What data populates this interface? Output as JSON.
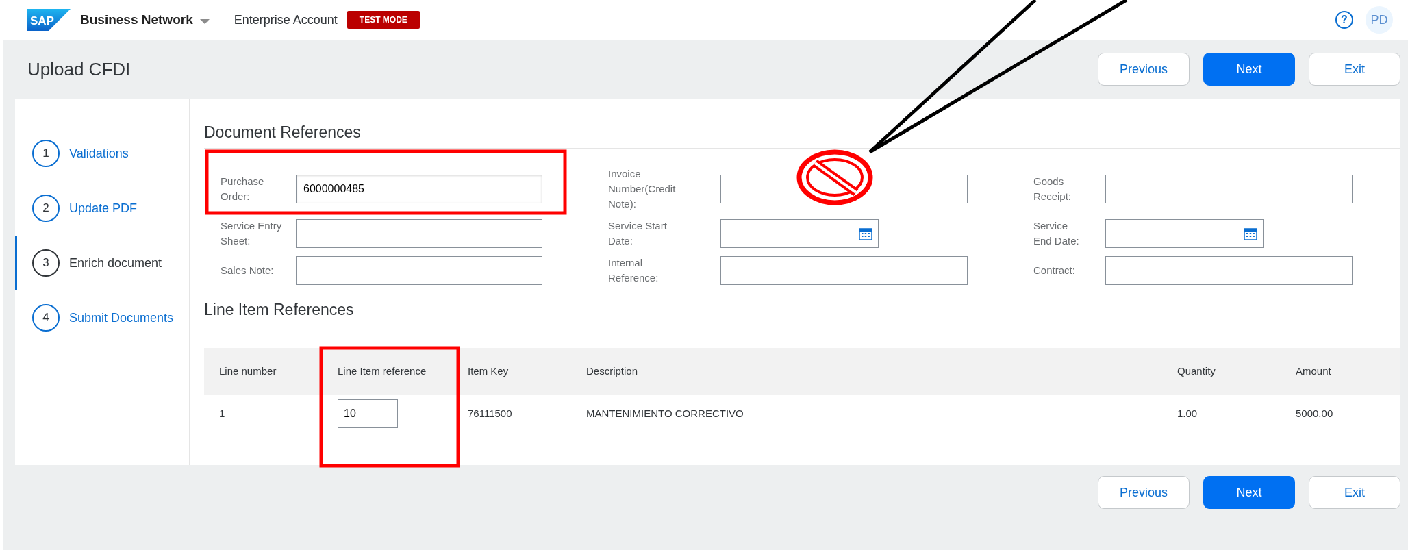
{
  "header": {
    "logo": "SAP",
    "product": "Business Network",
    "account": "Enterprise Account",
    "mode_badge": "TEST MODE",
    "help": "?",
    "avatar": "PD"
  },
  "page": {
    "title": "Upload CFDI",
    "actions": [
      {
        "label": "Previous",
        "kind": "secondary"
      },
      {
        "label": "Next",
        "kind": "primary"
      },
      {
        "label": "Exit",
        "kind": "secondary"
      }
    ]
  },
  "steps": [
    {
      "number": "1",
      "label": "Validations",
      "selected": false
    },
    {
      "number": "2",
      "label": "Update PDF",
      "selected": false
    },
    {
      "number": "3",
      "label": "Enrich document",
      "selected": true
    },
    {
      "number": "4",
      "label": "Submit Documents",
      "selected": false
    }
  ],
  "document_references": {
    "title": "Document References",
    "fields": [
      {
        "label": "Purchase Order:",
        "value": "6000000485",
        "kind": "text"
      },
      {
        "label": "Invoice Number(Credit Note):",
        "kind": "text"
      },
      {
        "label": "Goods Receipt:",
        "kind": "text"
      },
      {
        "label": "Service Entry Sheet:",
        "kind": "text"
      },
      {
        "label": "Service Start Date:",
        "kind": "date"
      },
      {
        "label": "Service End Date:",
        "kind": "date"
      },
      {
        "label": "Sales Note:",
        "kind": "text"
      },
      {
        "label": "Internal Reference:",
        "kind": "text"
      },
      {
        "label": "Contract:",
        "kind": "text"
      }
    ]
  },
  "line_item_references": {
    "title": "Line Item References",
    "columns": [
      "Line number",
      "Line Item reference",
      "Item Key",
      "Description",
      "Quantity",
      "Amount"
    ],
    "rows": [
      {
        "line_number": "1",
        "line_item_reference": "10",
        "item_key": "76111500",
        "description": "MANTENIMIENTO CORRECTIVO",
        "quantity": "1.00",
        "amount": "5000.00"
      }
    ]
  },
  "footer_actions": [
    {
      "label": "Previous",
      "kind": "secondary"
    },
    {
      "label": "Next",
      "kind": "primary"
    },
    {
      "label": "Exit",
      "kind": "secondary"
    }
  ]
}
